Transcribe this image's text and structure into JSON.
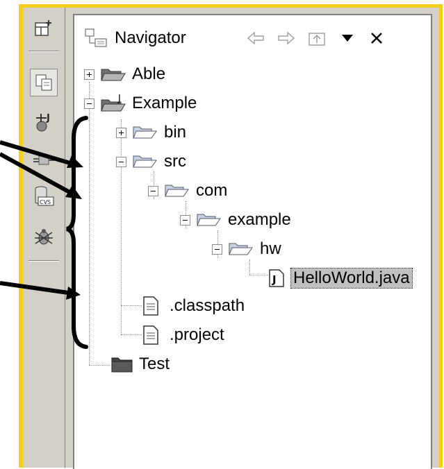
{
  "view": {
    "title": "Navigator",
    "tab_icon": "navigator-view-icon",
    "toolbar": {
      "back_icon": "back-arrow-icon",
      "forward_icon": "forward-arrow-icon",
      "up_icon": "go-up-icon",
      "menu_icon": "view-menu-triangle-icon",
      "close_icon": "close-icon"
    }
  },
  "perspective_bar": {
    "items": [
      {
        "icon": "open-perspective-icon"
      },
      {
        "icon": "resource-perspective-icon",
        "active": true
      },
      {
        "icon": "java-perspective-icon"
      },
      {
        "icon": "plugin-development-icon"
      },
      {
        "icon": "cvs-repository-icon",
        "badge": "CVS"
      },
      {
        "icon": "debug-perspective-icon"
      }
    ]
  },
  "tree": {
    "nodes": [
      {
        "label": "Able",
        "type": "project-open",
        "expander": "plus"
      },
      {
        "label": "Example",
        "type": "java-project",
        "expander": "minus",
        "badge": "J"
      },
      {
        "label": "bin",
        "type": "folder",
        "expander": "plus"
      },
      {
        "label": "src",
        "type": "folder",
        "expander": "minus"
      },
      {
        "label": "com",
        "type": "folder",
        "expander": "minus"
      },
      {
        "label": "example",
        "type": "folder",
        "expander": "minus"
      },
      {
        "label": "hw",
        "type": "folder",
        "expander": "minus"
      },
      {
        "label": "HelloWorld.java",
        "type": "java-file",
        "selected": true,
        "badge": "J"
      },
      {
        "label": ".classpath",
        "type": "text-file"
      },
      {
        "label": ".project",
        "type": "text-file"
      },
      {
        "label": "Test",
        "type": "project-closed"
      }
    ]
  },
  "colors": {
    "frame": "#f6cf1e",
    "chrome": "#d4d0c8",
    "selection": "#c0c0c0",
    "folder": "#8aa0c8"
  }
}
